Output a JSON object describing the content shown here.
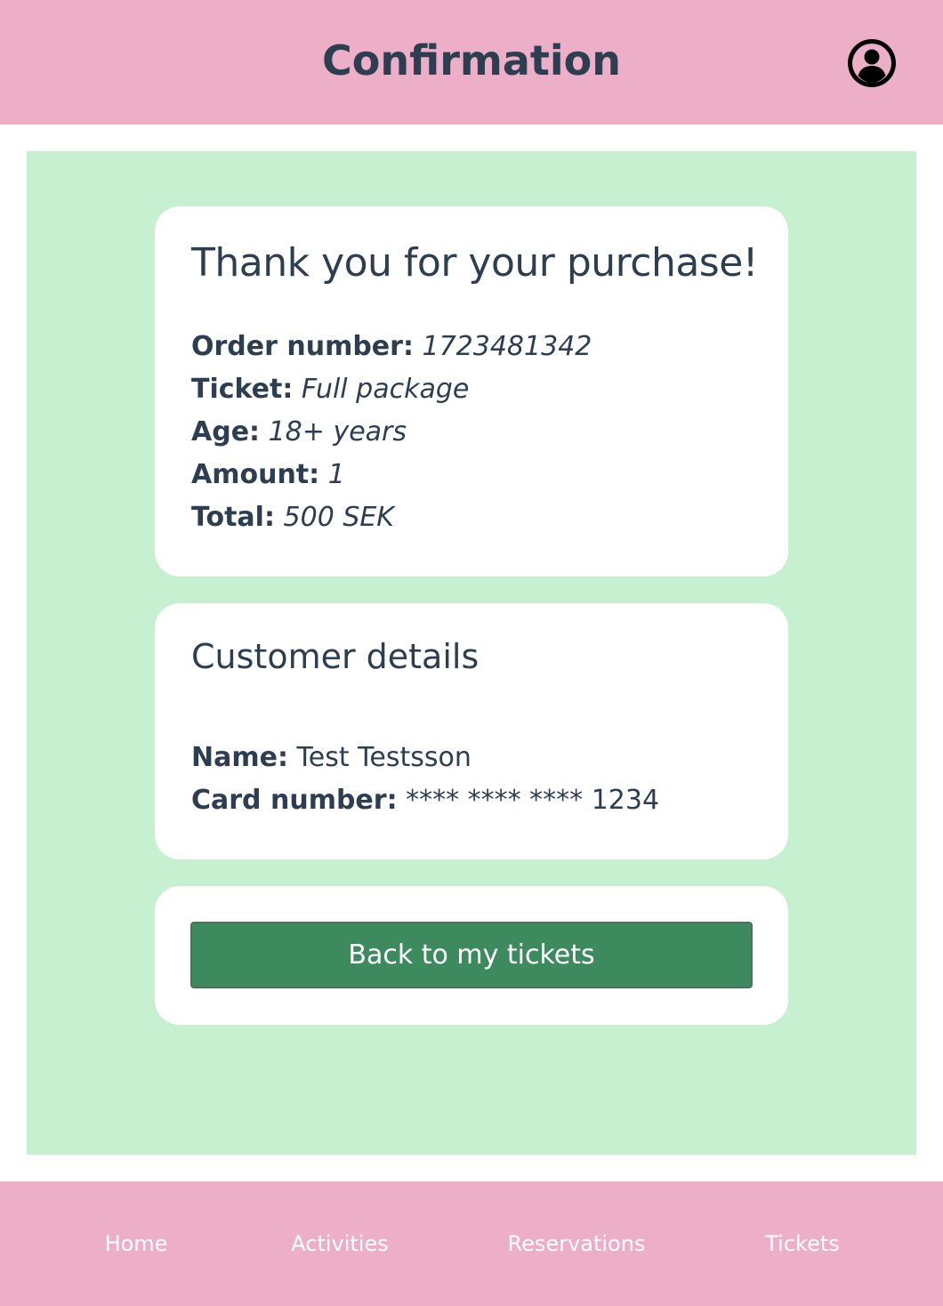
{
  "header": {
    "title": "Confirmation",
    "profile_icon": "account-circle-icon"
  },
  "order_card": {
    "heading": "Thank you for your purchase!",
    "order_number_label": "Order number:",
    "order_number_value": "1723481342",
    "ticket_label": "Ticket:",
    "ticket_value": "Full package",
    "age_label": "Age:",
    "age_value": "18+ years",
    "amount_label": "Amount:",
    "amount_value": "1",
    "total_label": "Total:",
    "total_value": "500 SEK"
  },
  "customer_card": {
    "heading": "Customer details",
    "name_label": "Name:",
    "name_value": "Test Testsson",
    "card_number_label": "Card number:",
    "card_number_value": "**** **** **** 1234"
  },
  "action": {
    "back_button_label": "Back to my tickets"
  },
  "footer_nav": {
    "items": [
      {
        "label": "Home"
      },
      {
        "label": "Activities"
      },
      {
        "label": "Reservations"
      },
      {
        "label": "Tickets"
      }
    ]
  },
  "colors": {
    "header_bg": "#ecafc7",
    "main_bg": "#c6f0d0",
    "card_bg": "#ffffff",
    "button_bg": "#3c8a5e",
    "text": "#2c3e50"
  }
}
